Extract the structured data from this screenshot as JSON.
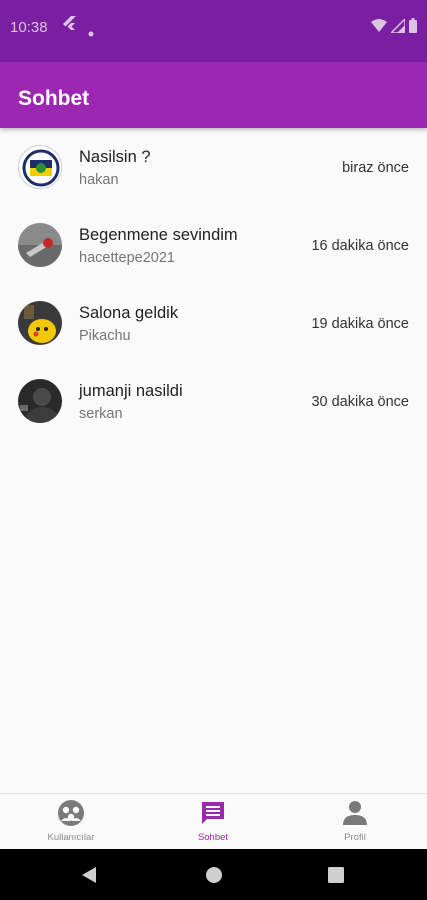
{
  "status_bar": {
    "time": "10:38"
  },
  "app_bar": {
    "title": "Sohbet"
  },
  "chats": [
    {
      "title": "Nasilsin ?",
      "user": "hakan",
      "time": "biraz önce",
      "avatar": "fenerbahce-logo"
    },
    {
      "title": "Begenmene sevindim",
      "user": "hacettepe2021",
      "time": "16 dakika önce",
      "avatar": "photo-red"
    },
    {
      "title": "Salona geldik",
      "user": "Pikachu",
      "time": "19 dakika önce",
      "avatar": "pikachu-photo"
    },
    {
      "title": "jumanji nasildi",
      "user": "serkan",
      "time": "30 dakika önce",
      "avatar": "dark-photo"
    }
  ],
  "bottom_nav": {
    "items": [
      {
        "label": "Kullanıcılar",
        "icon": "users-icon",
        "active": false
      },
      {
        "label": "Sohbet",
        "icon": "chat-icon",
        "active": true
      },
      {
        "label": "Profil",
        "icon": "person-icon",
        "active": false
      }
    ]
  },
  "colors": {
    "primary": "#9c27b0",
    "primary_dark": "#7b1fa2"
  }
}
